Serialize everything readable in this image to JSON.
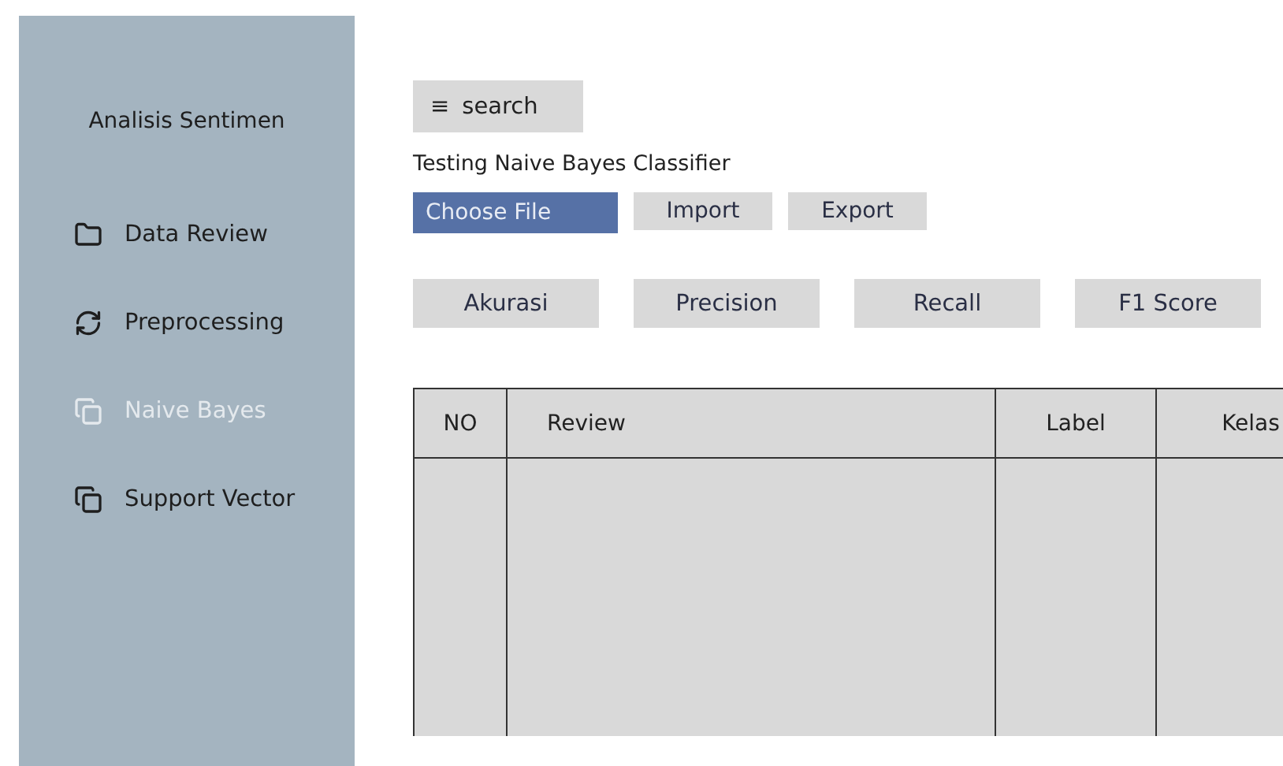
{
  "sidebar": {
    "title": "Analisis Sentimen",
    "items": [
      {
        "label": "Data Review",
        "selected": false
      },
      {
        "label": "Preprocessing",
        "selected": false
      },
      {
        "label": "Naive Bayes",
        "selected": true
      },
      {
        "label": "Support Vector",
        "selected": false
      }
    ]
  },
  "search": {
    "icon": "≡",
    "label": "search"
  },
  "heading": "Testing Naive Bayes Classifier",
  "file_buttons": [
    {
      "label": "Choose File",
      "kind": "primary"
    },
    {
      "label": "Import",
      "kind": "plain"
    },
    {
      "label": "Export",
      "kind": "plain"
    }
  ],
  "metric_buttons": [
    "Akurasi",
    "Precision",
    "Recall",
    "F1 Score"
  ],
  "table": {
    "columns": [
      "NO",
      "Review",
      "Label",
      "Kelas"
    ]
  }
}
